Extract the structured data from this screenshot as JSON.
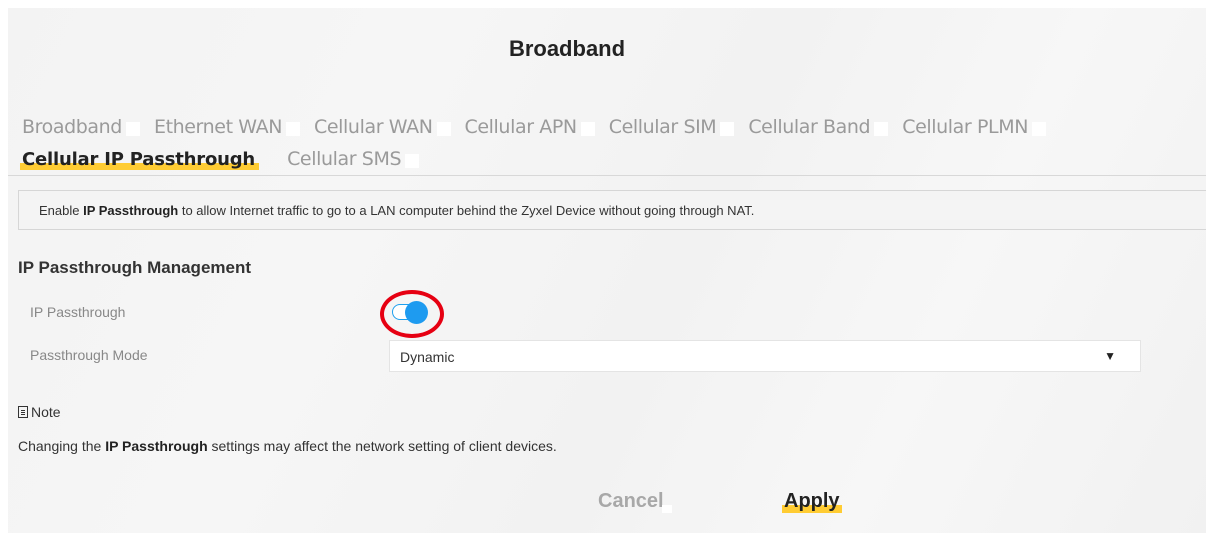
{
  "page": {
    "title": "Broadband"
  },
  "tabs": [
    {
      "label": "Broadband"
    },
    {
      "label": "Ethernet WAN"
    },
    {
      "label": "Cellular WAN"
    },
    {
      "label": "Cellular APN"
    },
    {
      "label": "Cellular SIM"
    },
    {
      "label": "Cellular Band"
    },
    {
      "label": "Cellular PLMN"
    },
    {
      "label": "Cellular IP Passthrough",
      "active": true
    },
    {
      "label": "Cellular SMS"
    }
  ],
  "info": {
    "prefix": "Enable ",
    "bold": "IP Passthrough",
    "suffix": " to allow Internet traffic to go to a LAN computer behind the Zyxel Device without going through NAT."
  },
  "section": {
    "title": "IP Passthrough Management"
  },
  "fields": {
    "ip_passthrough": {
      "label": "IP Passthrough",
      "enabled": true
    },
    "mode": {
      "label": "Passthrough Mode",
      "value": "Dynamic"
    }
  },
  "note": {
    "heading": "Note",
    "icon": "note-icon",
    "prefix": "Changing the ",
    "bold": "IP Passthrough",
    "suffix": " settings may affect the network setting of client devices."
  },
  "buttons": {
    "cancel": "Cancel",
    "apply": "Apply"
  },
  "colors": {
    "accent": "#ffcc33",
    "toggle": "#1e9bf0",
    "highlight": "#e60012"
  }
}
